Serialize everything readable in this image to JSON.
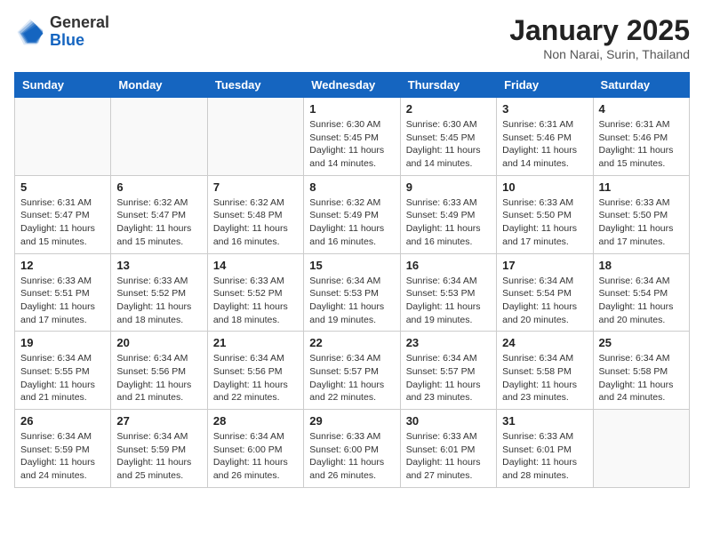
{
  "header": {
    "logo_general": "General",
    "logo_blue": "Blue",
    "month_title": "January 2025",
    "location": "Non Narai, Surin, Thailand"
  },
  "days_of_week": [
    "Sunday",
    "Monday",
    "Tuesday",
    "Wednesday",
    "Thursday",
    "Friday",
    "Saturday"
  ],
  "weeks": [
    [
      {
        "num": "",
        "info": ""
      },
      {
        "num": "",
        "info": ""
      },
      {
        "num": "",
        "info": ""
      },
      {
        "num": "1",
        "info": "Sunrise: 6:30 AM\nSunset: 5:45 PM\nDaylight: 11 hours and 14 minutes."
      },
      {
        "num": "2",
        "info": "Sunrise: 6:30 AM\nSunset: 5:45 PM\nDaylight: 11 hours and 14 minutes."
      },
      {
        "num": "3",
        "info": "Sunrise: 6:31 AM\nSunset: 5:46 PM\nDaylight: 11 hours and 14 minutes."
      },
      {
        "num": "4",
        "info": "Sunrise: 6:31 AM\nSunset: 5:46 PM\nDaylight: 11 hours and 15 minutes."
      }
    ],
    [
      {
        "num": "5",
        "info": "Sunrise: 6:31 AM\nSunset: 5:47 PM\nDaylight: 11 hours and 15 minutes."
      },
      {
        "num": "6",
        "info": "Sunrise: 6:32 AM\nSunset: 5:47 PM\nDaylight: 11 hours and 15 minutes."
      },
      {
        "num": "7",
        "info": "Sunrise: 6:32 AM\nSunset: 5:48 PM\nDaylight: 11 hours and 16 minutes."
      },
      {
        "num": "8",
        "info": "Sunrise: 6:32 AM\nSunset: 5:49 PM\nDaylight: 11 hours and 16 minutes."
      },
      {
        "num": "9",
        "info": "Sunrise: 6:33 AM\nSunset: 5:49 PM\nDaylight: 11 hours and 16 minutes."
      },
      {
        "num": "10",
        "info": "Sunrise: 6:33 AM\nSunset: 5:50 PM\nDaylight: 11 hours and 17 minutes."
      },
      {
        "num": "11",
        "info": "Sunrise: 6:33 AM\nSunset: 5:50 PM\nDaylight: 11 hours and 17 minutes."
      }
    ],
    [
      {
        "num": "12",
        "info": "Sunrise: 6:33 AM\nSunset: 5:51 PM\nDaylight: 11 hours and 17 minutes."
      },
      {
        "num": "13",
        "info": "Sunrise: 6:33 AM\nSunset: 5:52 PM\nDaylight: 11 hours and 18 minutes."
      },
      {
        "num": "14",
        "info": "Sunrise: 6:33 AM\nSunset: 5:52 PM\nDaylight: 11 hours and 18 minutes."
      },
      {
        "num": "15",
        "info": "Sunrise: 6:34 AM\nSunset: 5:53 PM\nDaylight: 11 hours and 19 minutes."
      },
      {
        "num": "16",
        "info": "Sunrise: 6:34 AM\nSunset: 5:53 PM\nDaylight: 11 hours and 19 minutes."
      },
      {
        "num": "17",
        "info": "Sunrise: 6:34 AM\nSunset: 5:54 PM\nDaylight: 11 hours and 20 minutes."
      },
      {
        "num": "18",
        "info": "Sunrise: 6:34 AM\nSunset: 5:54 PM\nDaylight: 11 hours and 20 minutes."
      }
    ],
    [
      {
        "num": "19",
        "info": "Sunrise: 6:34 AM\nSunset: 5:55 PM\nDaylight: 11 hours and 21 minutes."
      },
      {
        "num": "20",
        "info": "Sunrise: 6:34 AM\nSunset: 5:56 PM\nDaylight: 11 hours and 21 minutes."
      },
      {
        "num": "21",
        "info": "Sunrise: 6:34 AM\nSunset: 5:56 PM\nDaylight: 11 hours and 22 minutes."
      },
      {
        "num": "22",
        "info": "Sunrise: 6:34 AM\nSunset: 5:57 PM\nDaylight: 11 hours and 22 minutes."
      },
      {
        "num": "23",
        "info": "Sunrise: 6:34 AM\nSunset: 5:57 PM\nDaylight: 11 hours and 23 minutes."
      },
      {
        "num": "24",
        "info": "Sunrise: 6:34 AM\nSunset: 5:58 PM\nDaylight: 11 hours and 23 minutes."
      },
      {
        "num": "25",
        "info": "Sunrise: 6:34 AM\nSunset: 5:58 PM\nDaylight: 11 hours and 24 minutes."
      }
    ],
    [
      {
        "num": "26",
        "info": "Sunrise: 6:34 AM\nSunset: 5:59 PM\nDaylight: 11 hours and 24 minutes."
      },
      {
        "num": "27",
        "info": "Sunrise: 6:34 AM\nSunset: 5:59 PM\nDaylight: 11 hours and 25 minutes."
      },
      {
        "num": "28",
        "info": "Sunrise: 6:34 AM\nSunset: 6:00 PM\nDaylight: 11 hours and 26 minutes."
      },
      {
        "num": "29",
        "info": "Sunrise: 6:33 AM\nSunset: 6:00 PM\nDaylight: 11 hours and 26 minutes."
      },
      {
        "num": "30",
        "info": "Sunrise: 6:33 AM\nSunset: 6:01 PM\nDaylight: 11 hours and 27 minutes."
      },
      {
        "num": "31",
        "info": "Sunrise: 6:33 AM\nSunset: 6:01 PM\nDaylight: 11 hours and 28 minutes."
      },
      {
        "num": "",
        "info": ""
      }
    ]
  ]
}
